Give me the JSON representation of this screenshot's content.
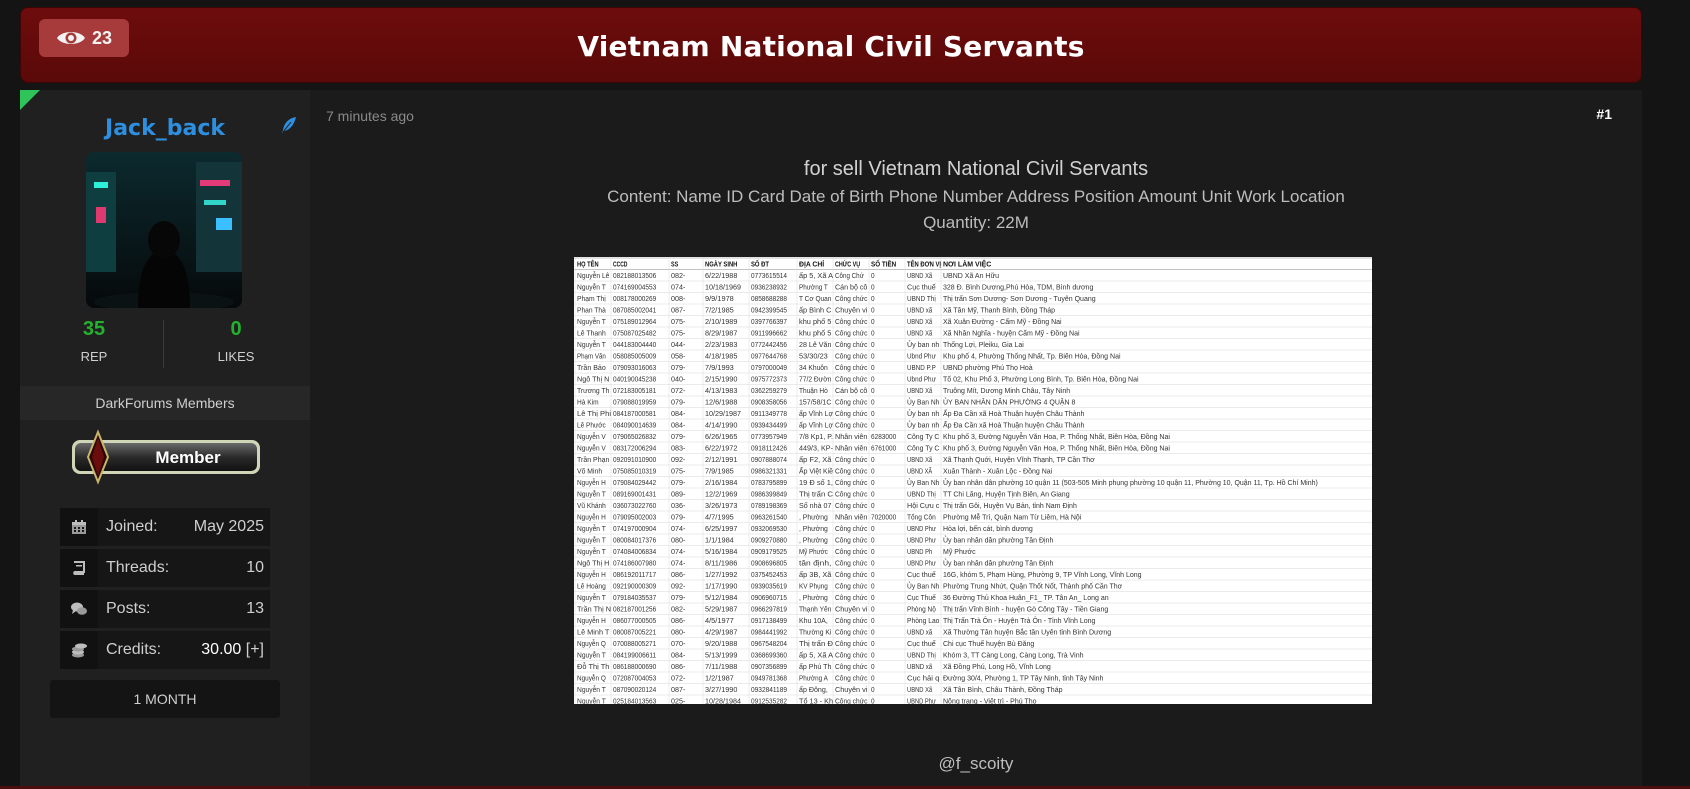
{
  "header": {
    "view_count": "23",
    "title": "Vietnam National Civil Servants"
  },
  "user": {
    "username": "Jack_back",
    "reputation": {
      "value": "35",
      "label": "REP"
    },
    "likes": {
      "value": "0",
      "label": "LIKES"
    },
    "usergroup": "DarkForums Members",
    "badge_text": "Member",
    "details": [
      {
        "label": "Joined:",
        "value": "May 2025",
        "icon": "calendar-icon"
      },
      {
        "label": "Threads:",
        "value": "10",
        "icon": "book-icon"
      },
      {
        "label": "Posts:",
        "value": "13",
        "icon": "comments-icon"
      },
      {
        "label": "Credits:",
        "value": "30.00",
        "extra": "[+]",
        "icon": "coins-icon"
      }
    ],
    "membership": "1 MONTH"
  },
  "post": {
    "time": "7 minutes ago",
    "number": "#1",
    "line1": "for sell Vietnam National Civil Servants",
    "line2": "Content: Name ID Card Date of Birth Phone Number Address Position Amount Unit Work Location",
    "line3": "Quantity: 22M",
    "signature": "@f_scoity"
  },
  "spreadsheet": {
    "headers": [
      "HỌ TÊN",
      "CCCD",
      "SS",
      "NGÀY SINH",
      "SỐ ĐT",
      "ĐỊA CHỈ",
      "CHỨC VỤ",
      "SỐ TIỀN",
      "TÊN ĐƠN VỊ",
      "NƠI LÀM VIỆC"
    ],
    "rows": [
      [
        "Nguyễn Lê",
        "082188013506",
        "082-",
        "6/22/1988",
        "0773615514",
        "ấp 5, Xã A",
        "Công Chứ",
        "0",
        "UBND Xã",
        "UBND Xã An Hữu"
      ],
      [
        "Nguyễn T",
        "074169004553",
        "074-",
        "10/18/1969",
        "0936238932",
        "Phường T",
        "Cán bộ cô",
        "0",
        "Cục thuế",
        "328 Đ. Bình Dương,Phú Hòa, TDM, Bình dương"
      ],
      [
        "Phạm Thị",
        "008178000269",
        "008-",
        "9/9/1978",
        "0858688288",
        "T Cơ Quan",
        "Công chức",
        "0",
        "UBND Thị",
        "Thị trấn Sơn Dương- Sơn Dương - Tuyên Quang"
      ],
      [
        "Phan Thà",
        "087085002041",
        "087-",
        "7/2/1985",
        "0942399545",
        "ấp Bình C",
        "Chuyên vi",
        "0",
        "UBND xã",
        "Xã Tân Mỹ, Thanh Bình, Đồng Tháp"
      ],
      [
        "Nguyễn T",
        "075189012964",
        "075-",
        "2/10/1989",
        "0397766397",
        "khu phố 5",
        "Công chức",
        "0",
        "UBND Xã",
        "Xã Xuân Đường - Cẩm Mỹ - Đồng Nai"
      ],
      [
        "Lê Thanh",
        "075087025482",
        "075-",
        "8/29/1987",
        "0911996662",
        "khu phố 5",
        "Công chức",
        "0",
        "UBND Xã",
        "Xã Nhân Nghĩa - huyện Cẩm Mỹ - Đồng Nai"
      ],
      [
        "Nguyễn T",
        "044183004440",
        "044-",
        "2/23/1983",
        "0772442456",
        "28 Lê Văn",
        "Công chức",
        "0",
        "Ủy ban nh",
        "Thống Lợi, Pleiku, Gia Lai"
      ],
      [
        "Phạm Văn",
        "058085005009",
        "058-",
        "4/18/1985",
        "0977644768",
        "53/30/23",
        "Công chức",
        "0",
        "Ubnd Phư",
        "Khu phố 4, Phường Thống Nhất, Tp. Biên Hòa, Đồng Nai"
      ],
      [
        "Trần Bảo",
        "079093016063",
        "079-",
        "7/9/1993",
        "0797000049",
        "34 Khuôn",
        "Công chức",
        "0",
        "UBND P.P",
        "UBND phường Phú Thọ Hoà"
      ],
      [
        "Ngô Thị N",
        "040190045238",
        "040-",
        "2/15/1990",
        "0975772373",
        "77/2 Đườn",
        "Công chức",
        "0",
        "Ubnd Phư",
        "Tổ 02, Khu Phố 3, Phường Long Bình, Tp. Biên Hòa, Đồng Nai"
      ],
      [
        "Trương Th",
        "072183005181",
        "072-",
        "4/13/1983",
        "0362259279",
        "Thuận Hò",
        "Cán bộ cô",
        "0",
        "UBND Xã",
        "Truông Mít, Dương Minh Châu, Tây Ninh"
      ],
      [
        "Hà Kim",
        "079088019959",
        "079-",
        "12/6/1988",
        "0908358056",
        "157/58/1C",
        "Công chức",
        "0",
        "Ủy Ban Nh",
        "ỦY BAN NHÂN DÂN PHƯỜNG 4 QUẬN 8"
      ],
      [
        "Lê Thị Phi",
        "084187000581",
        "084-",
        "10/29/1987",
        "0911349778",
        "ấp Vĩnh Lợ",
        "Công chức",
        "0",
        "Ủy ban nh",
        "Ấp Đa Cần xã Hoà Thuận huyện Châu Thành"
      ],
      [
        "Lê Phước",
        "084090014639",
        "084-",
        "4/14/1990",
        "0939434499",
        "ấp Vĩnh Lợ",
        "Công chức",
        "0",
        "Ủy ban nh",
        "Ấp Đa Cần xã Hoà Thuận huyện Châu Thành"
      ],
      [
        "Nguyễn V",
        "079065026832",
        "079-",
        "6/26/1965",
        "0773957949",
        "7/8 Kp1, P.",
        "Nhân viên",
        "6283000",
        "Công Ty C",
        "Khu phố 3, Đường Nguyễn Văn Hoa, P. Thống Nhất, Biên Hòa, Đồng Nai"
      ],
      [
        "Nguyễn V",
        "083172006294",
        "083-",
        "6/22/1972",
        "0918112426",
        "449/3, KP-",
        "Nhân viên",
        "6761000",
        "Công Ty C",
        "Khu phố 3, Đường Nguyễn Văn Hoa, P. Thống Nhất, Biên Hòa, Đồng Nai"
      ],
      [
        "Trần Phạn",
        "092091010900",
        "092-",
        "2/12/1991",
        "0907888074",
        "ấp F2, Xã",
        "Công chức",
        "0",
        "UBND Xã",
        "Xã Thạnh Quới, Huyện Vĩnh Thạnh, TP Cần Thơ"
      ],
      [
        "Võ Minh",
        "075085010319",
        "075-",
        "7/9/1985",
        "0986321331",
        "Ấp Việt Kiề",
        "Công chức",
        "0",
        "UBND XÃ",
        "Xuân Thành - Xuân Lộc - Đồng Nai"
      ],
      [
        "Nguyễn H",
        "079084029442",
        "079-",
        "2/16/1984",
        "0783795899",
        "19 Đ số 1,",
        "Công chức",
        "0",
        "Ủy Ban Nh",
        "Ủy ban nhân dân phường 10 quận 11 (503-505 Minh phụng phường 10 quận 11, Phường 10, Quận 11, Tp. Hồ Chí Minh)"
      ],
      [
        "Nguyễn T",
        "089169001431",
        "089-",
        "12/2/1969",
        "0986399849",
        "Thị trấn C",
        "Công chức",
        "0",
        "UBND Thị",
        "TT Chi Lăng, Huyện Tịnh Biên, An Giang"
      ],
      [
        "Vũ Khánh",
        "036073022760",
        "036-",
        "3/26/1973",
        "0789198369",
        "Số nhà 07",
        "Công chức",
        "0",
        "Hội Cựu c",
        "Thị trấn Gôi, Huyện Vụ Bản, tỉnh Nam Định"
      ],
      [
        "Nguyễn H",
        "079095002003",
        "079-",
        "4/7/1995",
        "0963261540",
        ", Phường",
        "Nhân viên",
        "7020000",
        "Tổng Côn",
        "Phường Mễ Trì, Quận Nam Từ Liêm, Hà Nội"
      ],
      [
        "Nguyễn T",
        "074197000904",
        "074-",
        "6/25/1997",
        "0932069530",
        ", Phường",
        "Công chức",
        "0",
        "UBND Phư",
        "Hòa lợi, bến cát, bình dương"
      ],
      [
        "Nguyễn T",
        "080084017376",
        "080-",
        "1/1/1984",
        "0909270880",
        ", Phường",
        "Công chức",
        "0",
        "UBND Phư",
        "Ủy ban nhân dân phường Tân Định"
      ],
      [
        "Nguyễn T",
        "074084006834",
        "074-",
        "5/16/1984",
        "0909179525",
        "Mỹ Phước",
        "Công chức",
        "0",
        "UBND Ph",
        "Mỹ Phước"
      ],
      [
        "Ngô Thị H",
        "074186007980",
        "074-",
        "8/11/1986",
        "0908696805",
        "tân định,",
        "Công chức",
        "0",
        "UBND Phư",
        "Ủy ban nhân dân phường Tân Định"
      ],
      [
        "Nguyễn H",
        "086192011717",
        "086-",
        "1/27/1992",
        "0375452453",
        "ấp 3B, Xã",
        "Công chức",
        "0",
        "Cục thuế",
        "16G, khóm 5, Phạm Hùng, Phường 9, TP Vĩnh Long, Vĩnh Long"
      ],
      [
        "Lê Hoàng",
        "092190000309",
        "092-",
        "1/17/1990",
        "0939035619",
        "KV Phụng",
        "Công chức",
        "0",
        "Ủy Ban Nh",
        "Phường Trung Nhứt, Quận Thốt Nốt, Thành phố Cần Thơ"
      ],
      [
        "Nguyễn T",
        "079184035537",
        "079-",
        "5/12/1984",
        "0906960715",
        ", Phường",
        "Công chức",
        "0",
        "Cục Thuế",
        "36 Đường Thủ Khoa Huân_F1_ TP. Tân An_ Long an"
      ],
      [
        "Trần Thị N",
        "082187001256",
        "082-",
        "5/29/1987",
        "0966297819",
        "Thạnh Yên",
        "Chuyên vi",
        "0",
        "Phòng Nộ",
        "Thị trấn Vĩnh Bình - huyện Gò Công Tây - Tiền Giang"
      ],
      [
        "Nguyễn H",
        "086077000505",
        "086-",
        "4/5/1977",
        "0917138499",
        "Khu 10A,",
        "Công chức",
        "0",
        "Phòng Lao",
        "Thị Trấn Trà Ôn - Huyện Trà Ôn - Tỉnh Vĩnh Long"
      ],
      [
        "Lê Minh T",
        "080087005221",
        "080-",
        "4/29/1987",
        "0984441992",
        "Thường Ki",
        "Công chức",
        "0",
        "UBND xã",
        "Xã Thường Tân huyện Bắc tân Uyên tỉnh Bình Dương"
      ],
      [
        "Nguyễn Q",
        "070088005271",
        "070-",
        "9/20/1988",
        "0967548204",
        "Thị trấn Đ",
        "Công chức",
        "0",
        "Cục thuế",
        "Chi cục Thuế huyện Bù Đăng"
      ],
      [
        "Nguyễn T",
        "084199006611",
        "084-",
        "5/13/1999",
        "0368699360",
        "ấp 5, Xã A",
        "Công chức",
        "0",
        "UBND Thị",
        "Khóm 3, TT Càng Long, Càng Long, Trà Vinh"
      ],
      [
        "Đỗ Thị Th",
        "086188000690",
        "086-",
        "7/11/1988",
        "0907356899",
        "ấp Phú Th",
        "Công chức",
        "0",
        "UBND xã",
        "Xã Đồng Phú, Long Hồ, Vĩnh Long"
      ],
      [
        "Nguyễn Q",
        "072087004053",
        "072-",
        "1/2/1987",
        "0949781368",
        "Phường A",
        "Công chức",
        "0",
        "Cục hải q",
        "Đường 30/4, Phường 1, TP Tây Ninh, tỉnh Tây Ninh"
      ],
      [
        "Nguyễn T",
        "087090020124",
        "087-",
        "3/27/1990",
        "0932841189",
        "ấp Đông,",
        "Chuyên vi",
        "0",
        "UBND Xã",
        "Xã Tân Bình, Châu Thành, Đồng Tháp"
      ],
      [
        "Nguyễn T",
        "025184013563",
        "025-",
        "10/28/1984",
        "0912535282",
        "Tổ 13 - Kh",
        "Công chức",
        "0",
        "UBND Phư",
        "Nông trang - Việt trì - Phú Thọ"
      ]
    ]
  },
  "colors": {
    "header_bg": "#6e0c0c",
    "badge_bg": "#a73b3b",
    "username": "#2e8fe0",
    "stat_value": "#24b12d",
    "new_post_flag": "#2ec45a"
  }
}
